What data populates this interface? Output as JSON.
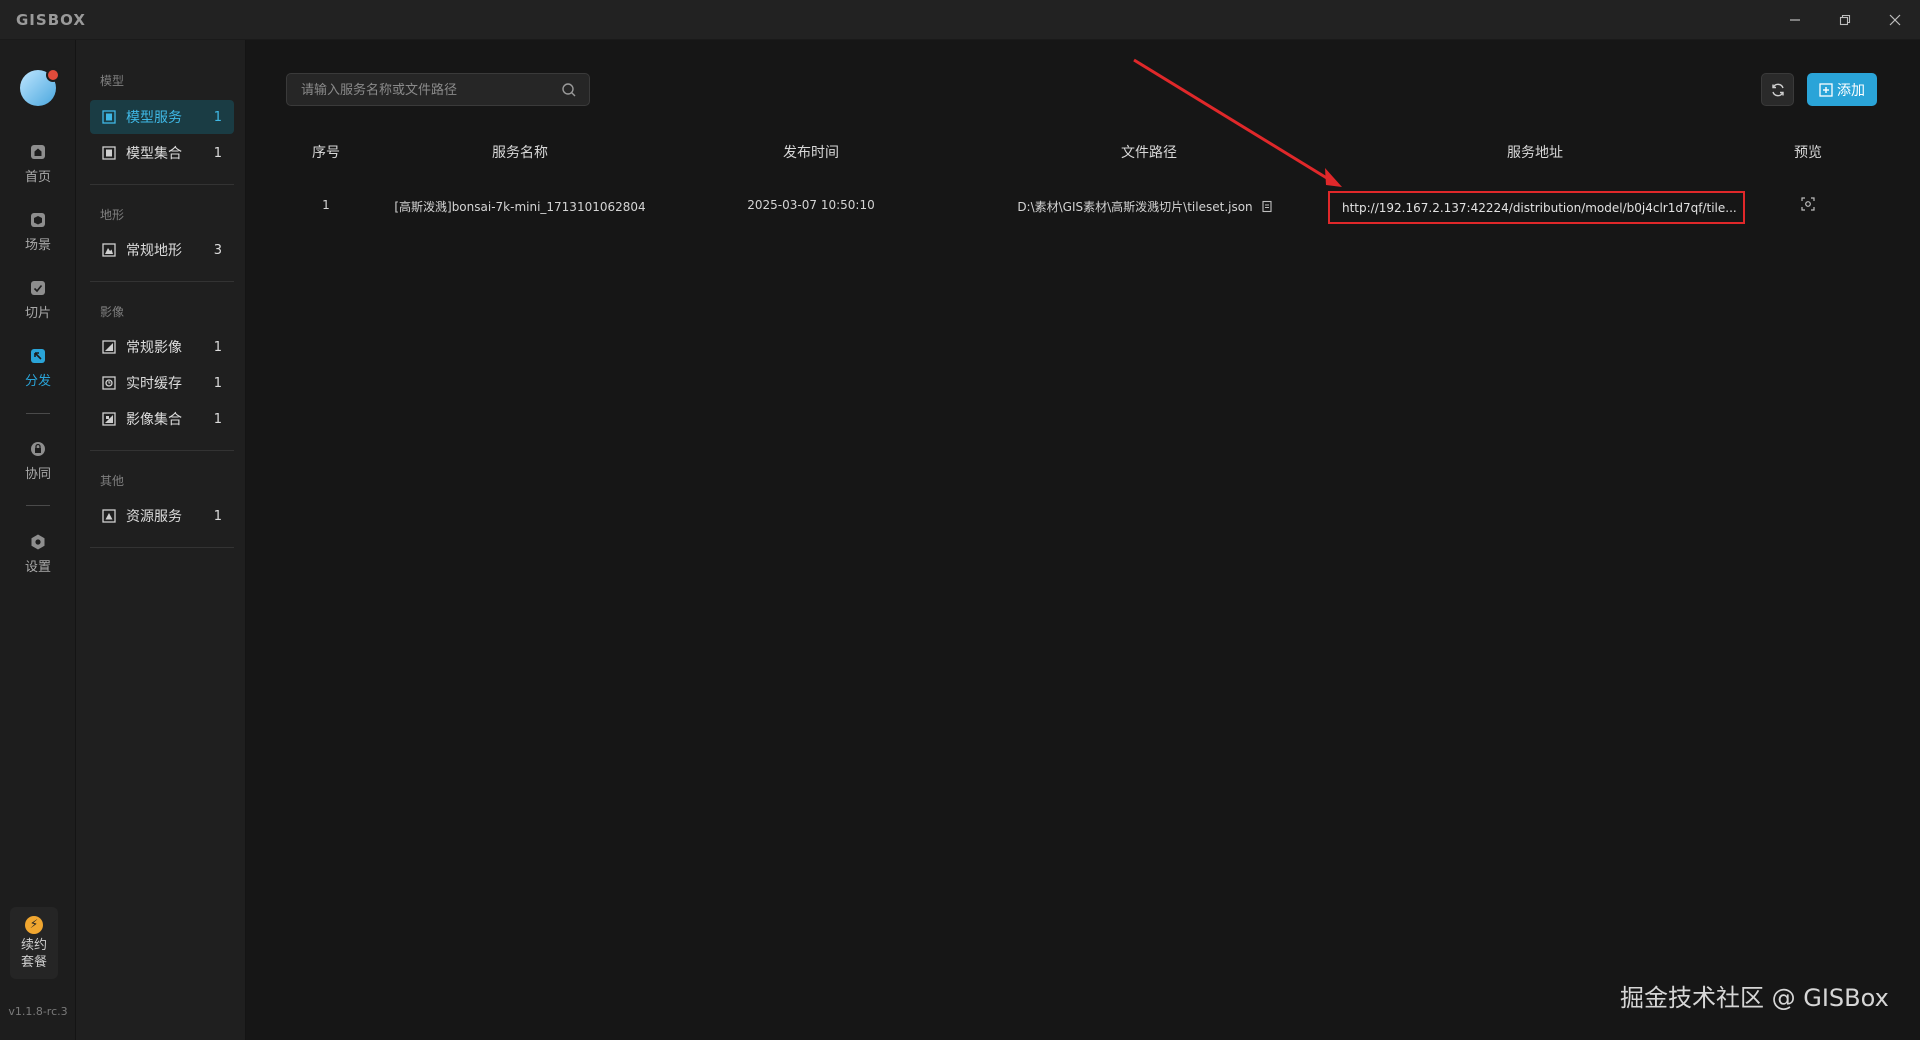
{
  "app": {
    "logo": "GISBOX",
    "version": "v1.1.8-rc.3"
  },
  "window_controls": {
    "minimize": "–",
    "maximize": "❐",
    "close": "✕"
  },
  "rail": {
    "items": [
      {
        "label": "首页",
        "icon": "home-icon"
      },
      {
        "label": "场景",
        "icon": "scene-icon"
      },
      {
        "label": "切片",
        "icon": "slice-icon"
      },
      {
        "label": "分发",
        "icon": "distribute-icon",
        "active": true
      },
      {
        "label": "协同",
        "icon": "collab-icon"
      },
      {
        "label": "设置",
        "icon": "settings-icon"
      }
    ],
    "package": {
      "line1": "续约",
      "line2": "套餐",
      "icon": "⚡"
    }
  },
  "sidebar": {
    "groups": [
      {
        "title": "模型",
        "items": [
          {
            "label": "模型服务",
            "count": "1",
            "active": true
          },
          {
            "label": "模型集合",
            "count": "1"
          }
        ]
      },
      {
        "title": "地形",
        "items": [
          {
            "label": "常规地形",
            "count": "3"
          }
        ]
      },
      {
        "title": "影像",
        "items": [
          {
            "label": "常规影像",
            "count": "1"
          },
          {
            "label": "实时缓存",
            "count": "1"
          },
          {
            "label": "影像集合",
            "count": "1"
          }
        ]
      },
      {
        "title": "其他",
        "items": [
          {
            "label": "资源服务",
            "count": "1"
          }
        ]
      }
    ]
  },
  "toolbar": {
    "search_placeholder": "请输入服务名称或文件路径",
    "add_label": "添加"
  },
  "table": {
    "headers": [
      "序号",
      "服务名称",
      "发布时间",
      "文件路径",
      "服务地址",
      "预览"
    ],
    "rows": [
      {
        "index": "1",
        "name": "[高斯泼溅]bonsai-7k-mini_1713101062804",
        "time": "2025-03-07 10:50:10",
        "path": "D:\\素材\\GIS素材\\高斯泼溅切片\\tileset.json",
        "url": "http://192.167.2.137:42224/distribution/model/b0j4clr1d7qf/tile..."
      }
    ]
  },
  "annotation": {
    "color": "#e0282a"
  },
  "watermark": "掘金技术社区 @ GISBox",
  "colors": {
    "accent": "#2aa4d8",
    "highlight": "#e0282a"
  }
}
